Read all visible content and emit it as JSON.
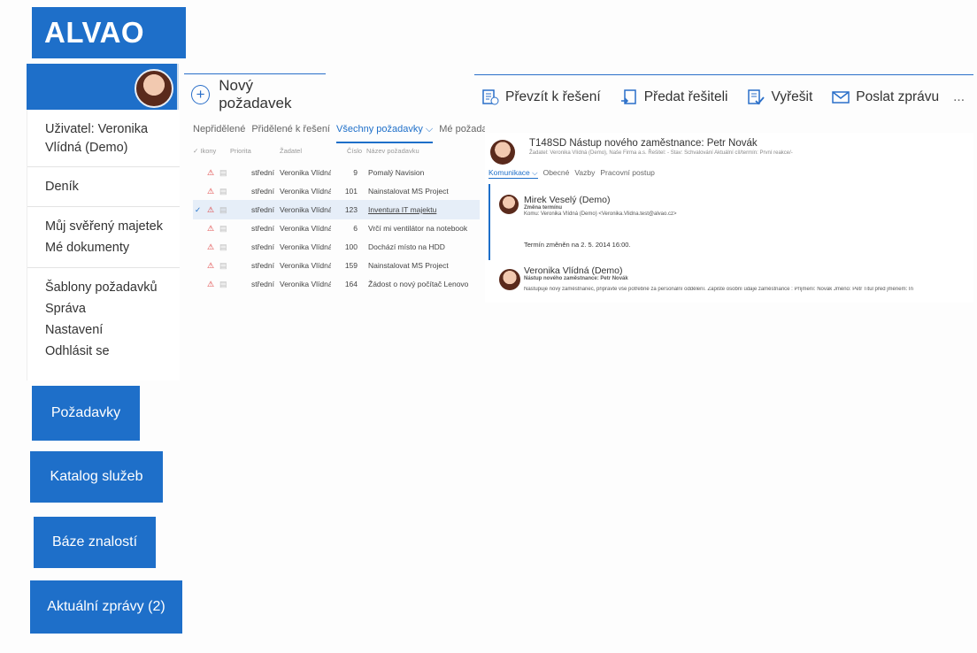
{
  "app": {
    "brand": "ALVAO"
  },
  "user": {
    "label": "Uživatel: Veronika Vlídná (Demo)"
  },
  "sidebar": {
    "groups": [
      [
        "Deník"
      ],
      [
        "Můj svěřený majetek",
        "Mé dokumenty"
      ],
      [
        "Šablony požadavků",
        "Správa",
        "Nastavení",
        "Odhlásit se"
      ]
    ]
  },
  "tiles": [
    "Požadavky",
    "Katalog služeb",
    "Báze znalostí",
    "Aktuální zprávy (2)"
  ],
  "toolbar": {
    "new_request": "Nový požadavek",
    "take": "Převzít k řešení",
    "handover": "Předat řešiteli",
    "resolve": "Vyřešit",
    "send": "Poslat zprávu",
    "more": "..."
  },
  "list": {
    "tabs": [
      "Nepřidělené",
      "Přidělené k řešení",
      "Všechny požadavky ⌵",
      "Mé požada"
    ],
    "headers": [
      "✓ Ikony",
      "Priorita",
      "Žadatel",
      "Číslo",
      "Název požadavku"
    ],
    "rows": [
      {
        "prio": "střední",
        "requester": "Veronika Vlídná",
        "number": "9",
        "name": "Pomalý Navision",
        "selected": false
      },
      {
        "prio": "střední",
        "requester": "Veronika Vlídná",
        "number": "101",
        "name": "Nainstalovat MS Project",
        "selected": false
      },
      {
        "prio": "střední",
        "requester": "Veronika Vlídná",
        "number": "123",
        "name": "Inventura IT majektu",
        "selected": true
      },
      {
        "prio": "střední",
        "requester": "Veronika Vlídná",
        "number": "6",
        "name": "Vrčí mi ventilátor na notebook",
        "selected": false
      },
      {
        "prio": "střední",
        "requester": "Veronika Vlídná",
        "number": "100",
        "name": "Dochází místo na HDD",
        "selected": false
      },
      {
        "prio": "střední",
        "requester": "Veronika Vlídná",
        "number": "159",
        "name": "Nainstalovat MS Project",
        "selected": false
      },
      {
        "prio": "střední",
        "requester": "Veronika Vlídná",
        "number": "164",
        "name": "Žádost o nový počítač Lenovo",
        "selected": false
      }
    ]
  },
  "detail": {
    "title": "T148SD Nástup nového zaměstnance: Petr Novák",
    "subtitle": "Žadatel: Veronika Vlídná (Demo), Naše Firma a.s.   Řešitel: -   Stav: Schvalování   Aktuální cíl/termín: První reakce/-",
    "tabs": [
      "Komunikace ⌵",
      "Obecné",
      "Vazby",
      "Pracovní postup"
    ],
    "messages": [
      {
        "author": "Mirek Veselý (Demo)",
        "subject": "Změna termínu",
        "to": "Komu: Veronika Vlídná (Demo) <Veronika.Vlidna.test@alvao.cz>",
        "body": "Termín změněn na 2. 5. 2014 16:00."
      },
      {
        "author": "Veronika Vlídná (Demo)",
        "subject": "Nástup nového zaměstnance: Petr Novák",
        "body": "Nastupuje nový zaměstnanec, připravte vše potřebné za personální oddělení. Zapište osobní údaje zaměstnance : Příjmení: Novák Jméno: Petr Titul před jménem: In"
      }
    ]
  },
  "colors": {
    "accent": "#1e6fc9"
  }
}
